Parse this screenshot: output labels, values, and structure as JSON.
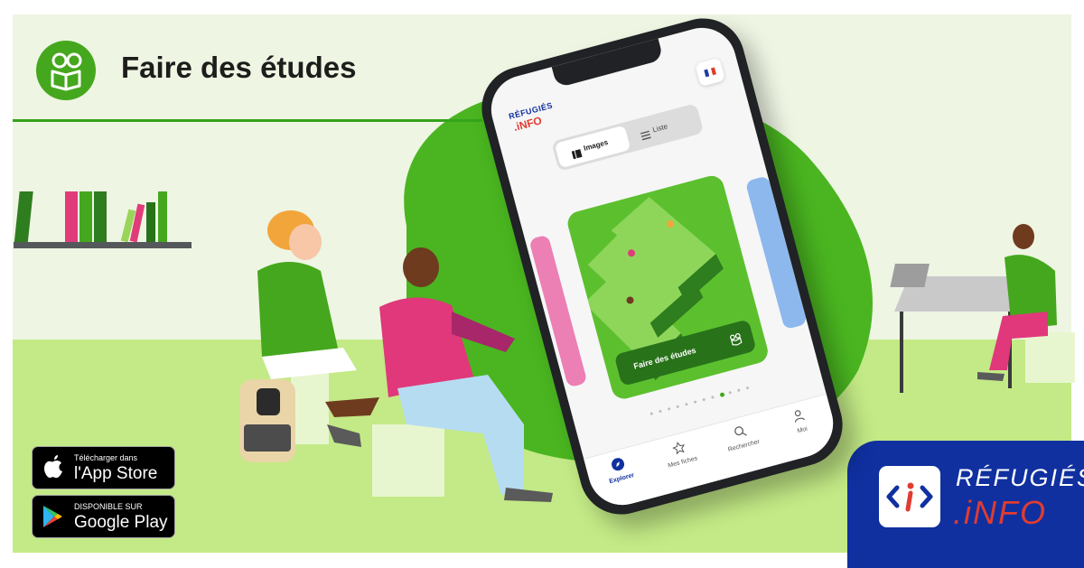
{
  "page": {
    "title": "Faire des études"
  },
  "stores": {
    "apple": {
      "small": "Télécharger dans",
      "big": "l'App Store"
    },
    "google": {
      "small": "DISPONIBLE SUR",
      "big": "Google Play"
    }
  },
  "brand": {
    "line1": "RÉFUGIÉS",
    "line2": ".iNFO",
    "icon_text": "<i>"
  },
  "phone": {
    "app_logo_line1": "RÉFUGIÉS",
    "app_logo_line2": ".iNFO",
    "language_flag": "french-flag",
    "view_toggle": {
      "images": "Images",
      "list": "Liste"
    },
    "card_label": "Faire des études",
    "carousel": {
      "count": 12,
      "active_index": 8
    },
    "tabs": [
      {
        "label": "Explorer",
        "icon": "compass-icon",
        "active": true
      },
      {
        "label": "Mes fiches",
        "icon": "star-icon",
        "active": false
      },
      {
        "label": "Rechercher",
        "icon": "search-icon",
        "active": false
      },
      {
        "label": "Moi",
        "icon": "person-icon",
        "active": false
      }
    ]
  },
  "colors": {
    "accent_green": "#45a71d",
    "dark_green": "#28721a",
    "brand_blue": "#1030a0",
    "brand_red": "#e03c30",
    "floor_green": "#c3ea86"
  }
}
